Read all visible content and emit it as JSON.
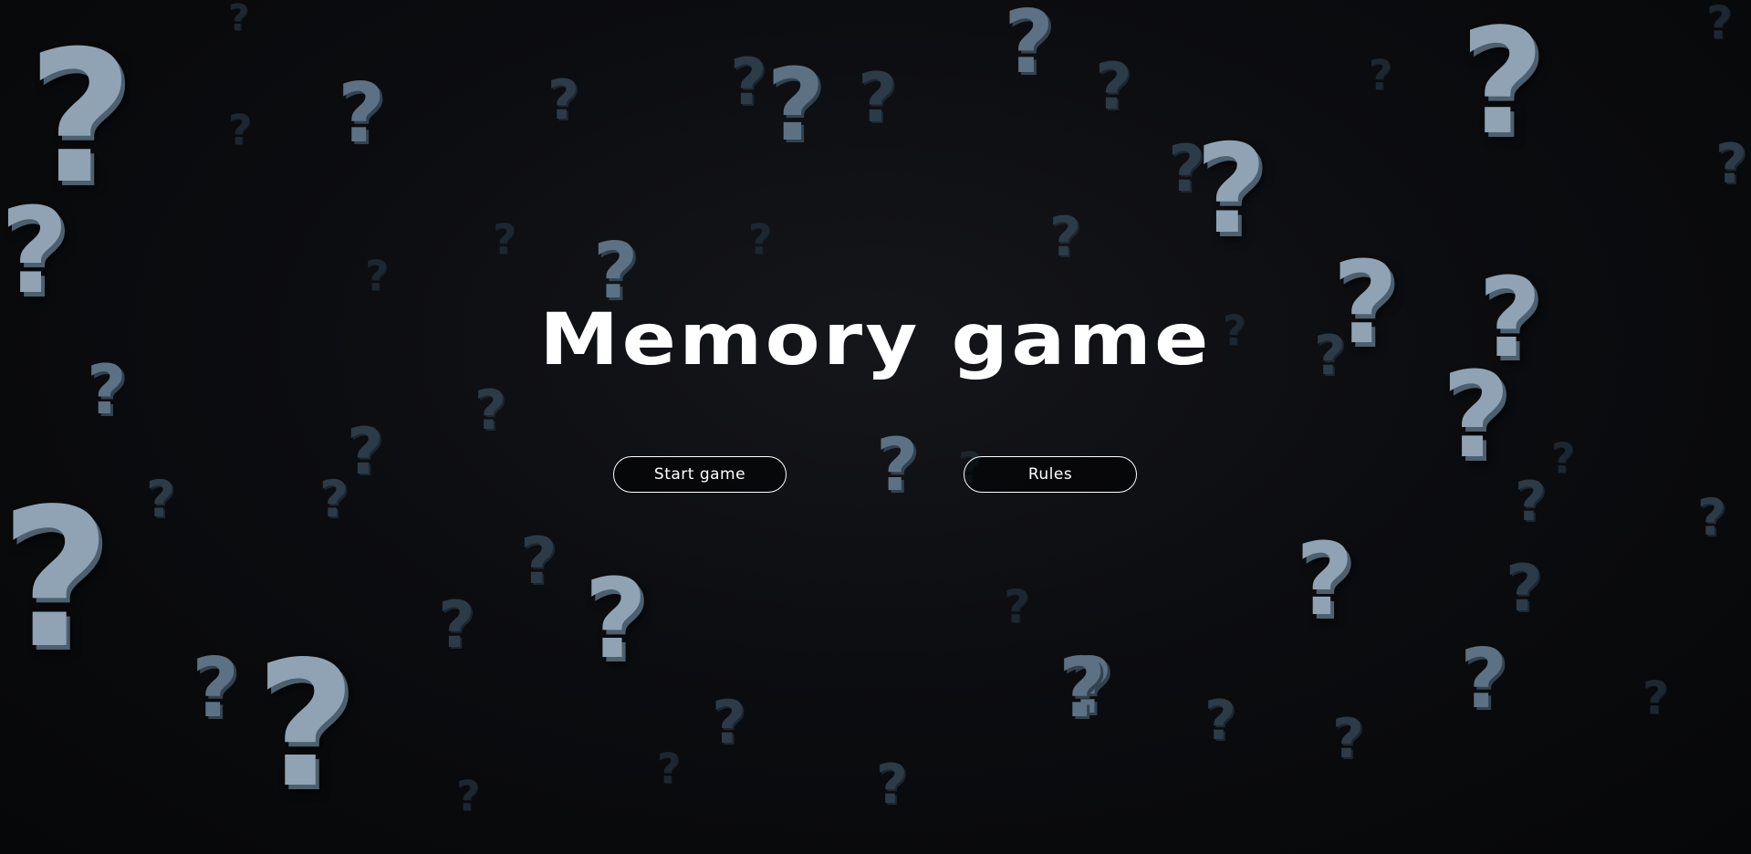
{
  "title": "Memory game",
  "buttons": {
    "start_label": "Start game",
    "rules_label": "Rules"
  },
  "background": {
    "glyph": "?",
    "icon": "question-mark-pattern"
  },
  "colors": {
    "background": "#08090b",
    "text": "#ffffff",
    "question_mark": "#8fa3b4"
  }
}
